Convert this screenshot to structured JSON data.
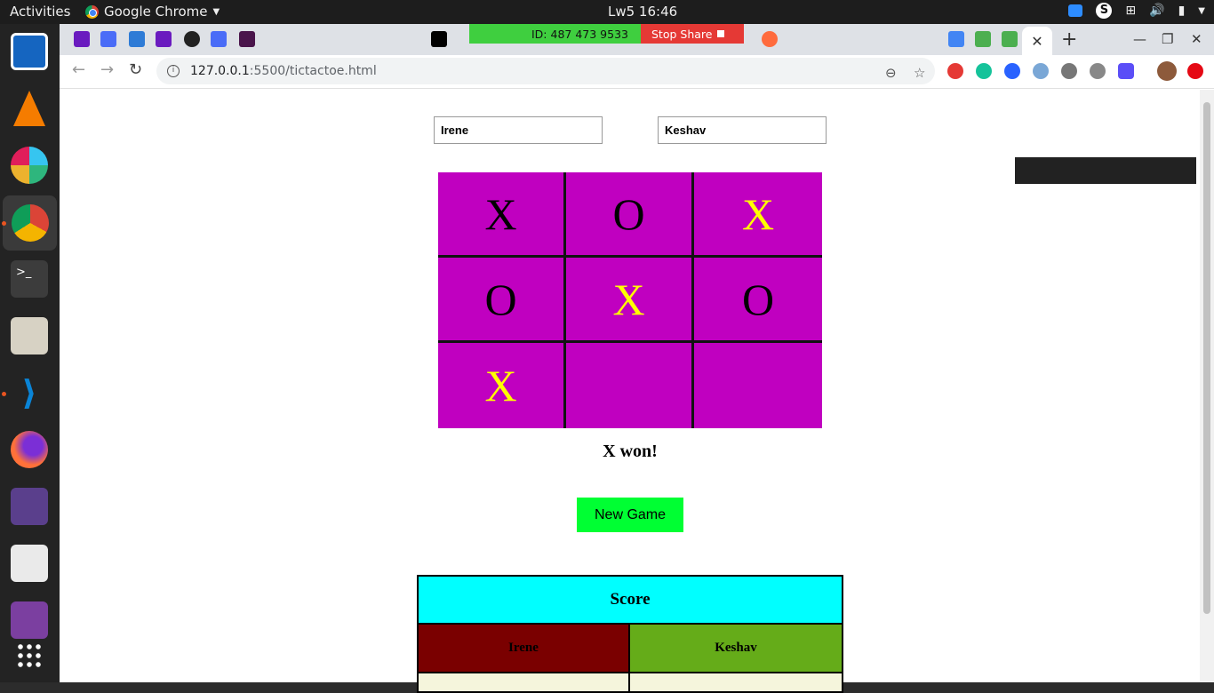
{
  "topbar": {
    "activities": "Activities",
    "app_name": "Google Chrome",
    "clock": "Lw5 16:46",
    "tray_s": "S"
  },
  "dock": {
    "items": [
      "libreoffice-writer-icon",
      "vlc-icon",
      "slack-icon",
      "chrome-icon",
      "terminal-icon",
      "archive-manager-icon",
      "vscode-icon",
      "firefox-icon",
      "video-player-icon",
      "files-icon",
      "media-icon",
      "show-apps-icon"
    ]
  },
  "share_bar": {
    "id_text": "ID: 487 473 9533",
    "stop_label": "Stop Share"
  },
  "tabs": {
    "active_close": "✕",
    "new_tab": "+"
  },
  "window_controls": {
    "minimize": "—",
    "restore": "❐",
    "close": "✕"
  },
  "address_bar": {
    "host": "127.0.0.1",
    "path": ":5500/tictactoe.html"
  },
  "players": {
    "player1": "Irene",
    "player2": "Keshav"
  },
  "board": {
    "cells": [
      {
        "mark": "X",
        "color": "#000000"
      },
      {
        "mark": "O",
        "color": "#000000"
      },
      {
        "mark": "X",
        "color": "#ffff00"
      },
      {
        "mark": "O",
        "color": "#000000"
      },
      {
        "mark": "X",
        "color": "#ffff00"
      },
      {
        "mark": "O",
        "color": "#000000"
      },
      {
        "mark": "X",
        "color": "#ffff00"
      },
      {
        "mark": "",
        "color": "#000000"
      },
      {
        "mark": "",
        "color": "#000000"
      }
    ],
    "background": "#c000c0"
  },
  "status": "X won!",
  "new_game_label": "New Game",
  "score": {
    "title": "Score",
    "player1": "Irene",
    "player2": "Keshav"
  },
  "colors": {
    "button": "#00ff33",
    "score_header": "#00ffff",
    "player1_cell": "#7a0000",
    "player2_cell": "#65ac19"
  }
}
